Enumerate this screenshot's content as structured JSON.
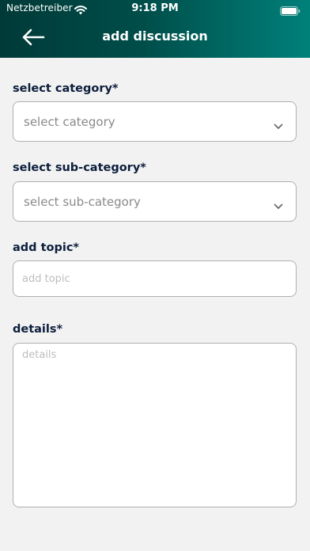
{
  "status_bar": {
    "carrier": "Netzbetreiber",
    "time": "9:18 PM"
  },
  "header": {
    "title": "add discussion",
    "back_icon": "arrow-left-icon",
    "gradient_colors": [
      "#003a38",
      "#004d49",
      "#00807a"
    ]
  },
  "form": {
    "category": {
      "label": "select category*",
      "value": "select category"
    },
    "sub_category": {
      "label": "select sub-category*",
      "value": "select sub-category"
    },
    "topic": {
      "label": "add topic*",
      "placeholder": "add topic"
    },
    "details": {
      "label": "details*",
      "placeholder": "details"
    }
  },
  "colors": {
    "label_text": "#0c1e3c",
    "background": "#f2f2f2",
    "border": "#b0b0b0"
  }
}
